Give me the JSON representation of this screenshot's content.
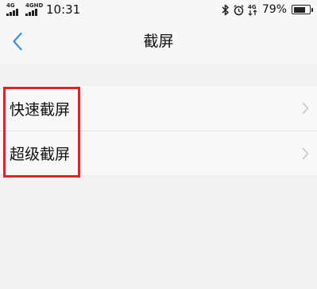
{
  "status_bar": {
    "network_1": "4G",
    "network_2": "4GHD",
    "time": "10:31",
    "icons": [
      "bluetooth-icon",
      "alarm-icon",
      "4g-data-icon"
    ],
    "data_indicator": "4G",
    "battery_percent": "79%",
    "battery_level": 0.79
  },
  "header": {
    "title": "截屏",
    "back_icon": "chevron-left-icon"
  },
  "list": {
    "items": [
      {
        "label": "快速截屏",
        "icon": "chevron-right-icon"
      },
      {
        "label": "超级截屏",
        "icon": "chevron-right-icon"
      }
    ]
  },
  "colors": {
    "accent_back": "#3a8ee6",
    "highlight_border": "#d8262c",
    "page_bg": "#f2f2f2",
    "bar_bg": "#f7f7f7",
    "list_bg": "#f8f8f8",
    "chevron": "#c4c4c4"
  }
}
